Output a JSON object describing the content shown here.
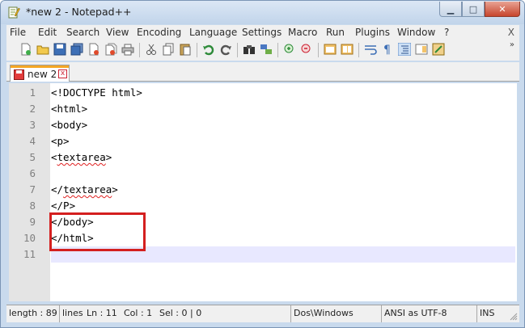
{
  "window": {
    "title": "*new  2 - Notepad++",
    "controls": {
      "minimize": "▁",
      "maximize": "□",
      "close": "✕"
    }
  },
  "menu": {
    "items": [
      "File",
      "Edit",
      "Search",
      "View",
      "Encoding",
      "Language",
      "Settings",
      "Macro",
      "Run",
      "Plugins",
      "Window",
      "?"
    ],
    "close_doc": "X"
  },
  "toolbar": {
    "overflow": "»",
    "icons": [
      "new-file-icon",
      "open-file-icon",
      "save-icon",
      "save-all-icon",
      "close-icon",
      "close-all-icon",
      "print-icon",
      "cut-icon",
      "copy-icon",
      "paste-icon",
      "undo-icon",
      "redo-icon",
      "find-icon",
      "replace-icon",
      "zoom-in-icon",
      "zoom-out-icon",
      "sync-vertical-icon",
      "sync-horizontal-icon",
      "word-wrap-icon",
      "show-all-chars-icon",
      "indent-guide-icon",
      "doc-map-icon",
      "function-list-icon"
    ]
  },
  "tab": {
    "label": "new  2",
    "close": "x",
    "accent_color": "#f5a623"
  },
  "editor": {
    "lines": [
      {
        "n": "1",
        "text": "<!DOCTYPE html>"
      },
      {
        "n": "2",
        "text": "<html>"
      },
      {
        "n": "3",
        "text": "<body>"
      },
      {
        "n": "4",
        "text": "<p>"
      },
      {
        "n": "5",
        "pre": "<",
        "spell": "textarea",
        "post": ">"
      },
      {
        "n": "6",
        "text": ""
      },
      {
        "n": "7",
        "pre": "</",
        "spell": "textarea",
        "post": ">"
      },
      {
        "n": "8",
        "text": "</P>"
      },
      {
        "n": "9",
        "text": "</body>"
      },
      {
        "n": "10",
        "text": "</html>"
      },
      {
        "n": "11",
        "text": ""
      }
    ],
    "highlight_color": "#d41f1f"
  },
  "status": {
    "length": "length : 89",
    "lines": "lines",
    "ln": "Ln : 11",
    "col": "Col : 1",
    "sel": "Sel : 0 | 0",
    "eol": "Dos\\Windows",
    "encoding": "ANSI as UTF-8",
    "mode": "INS"
  }
}
